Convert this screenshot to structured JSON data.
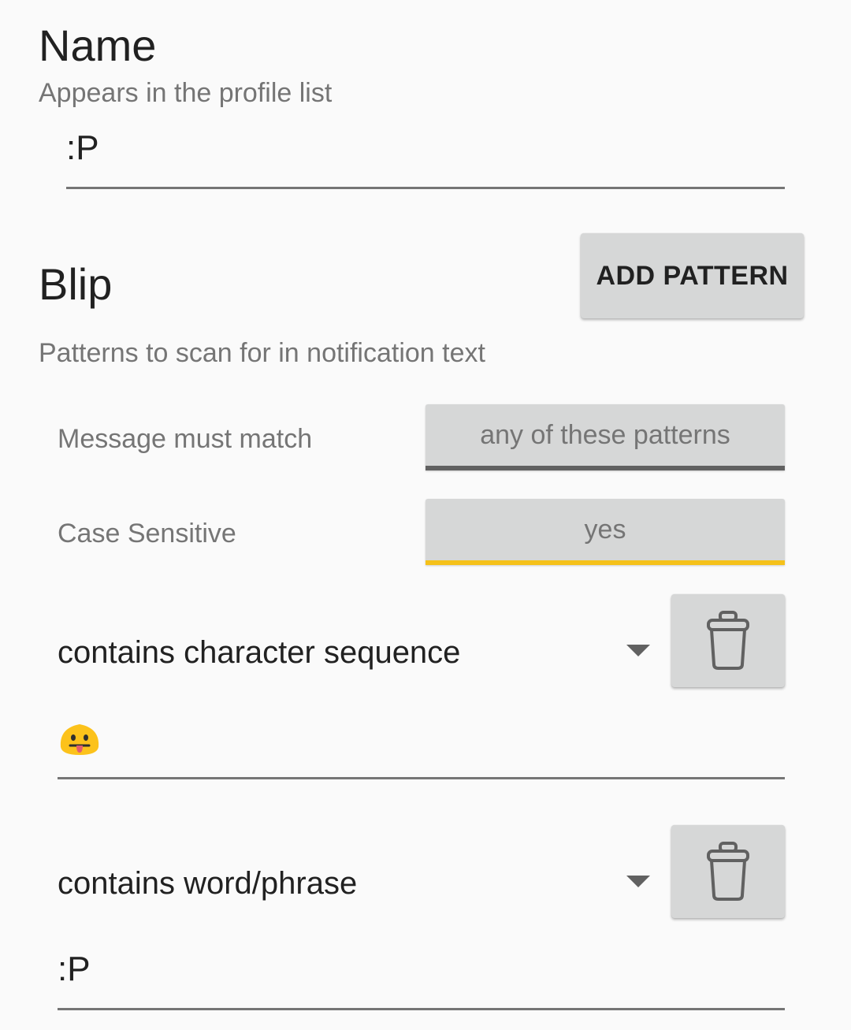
{
  "name_section": {
    "title": "Name",
    "subtitle": "Appears in the profile list",
    "value": ":P"
  },
  "blip_section": {
    "title": "Blip",
    "add_button_label": "ADD PATTERN",
    "subtitle": "Patterns to scan for in notification text",
    "match_label": "Message must match",
    "match_value": "any of these patterns",
    "case_label": "Case Sensitive",
    "case_value": "yes"
  },
  "patterns": [
    {
      "type": "contains character sequence",
      "value_icon": "tongue-out-emoji-icon"
    },
    {
      "type": "contains word/phrase",
      "value": ":P"
    }
  ],
  "colors": {
    "background": "#fafafa",
    "button": "#d6d7d7",
    "accent_yellow": "#f5c11a",
    "underline_gray": "#616161"
  }
}
